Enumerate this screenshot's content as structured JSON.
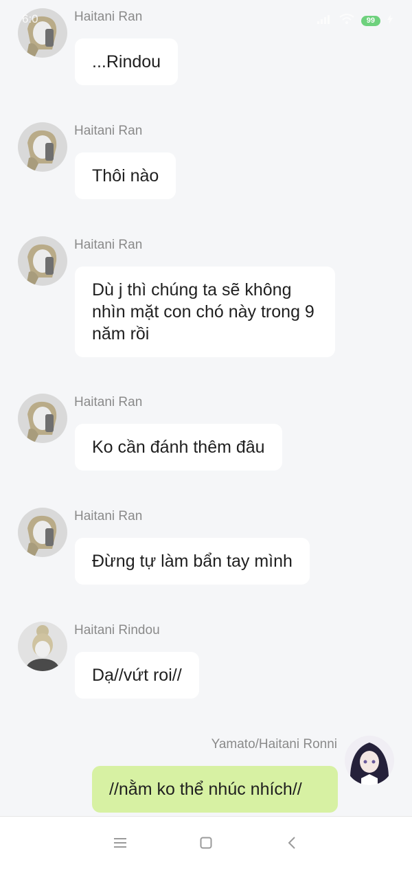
{
  "status_bar": {
    "time": "6:0",
    "battery": "99"
  },
  "messages": [
    {
      "sender": "Haitani Ran",
      "text": "...Rindou",
      "side": "left",
      "avatar": "ran"
    },
    {
      "sender": "Haitani Ran",
      "text": "Thôi nào",
      "side": "left",
      "avatar": "ran"
    },
    {
      "sender": "Haitani Ran",
      "text": "Dù j thì chúng ta sẽ không nhìn mặt con chó này trong 9 năm rồi",
      "side": "left",
      "avatar": "ran"
    },
    {
      "sender": "Haitani Ran",
      "text": "Ko cần đánh thêm đâu",
      "side": "left",
      "avatar": "ran"
    },
    {
      "sender": "Haitani Ran",
      "text": "Đừng tự làm bẩn tay mình",
      "side": "left",
      "avatar": "ran"
    },
    {
      "sender": "Haitani Rindou",
      "text": "Dạ//vứt roi//",
      "side": "left",
      "avatar": "rindou"
    },
    {
      "sender": "Yamato/Haitani Ronni",
      "text": "//nằm ko thể nhúc nhích//",
      "side": "right",
      "avatar": "ronni"
    }
  ],
  "nav": {
    "menu_icon": "menu-icon",
    "home_icon": "home-square-icon",
    "back_icon": "back-chevron-icon"
  },
  "colors": {
    "background": "#f5f6f8",
    "bubble_left": "#ffffff",
    "bubble_right": "#d7f1a3",
    "sender_text": "#8a8a8a",
    "battery": "#35c24a"
  }
}
